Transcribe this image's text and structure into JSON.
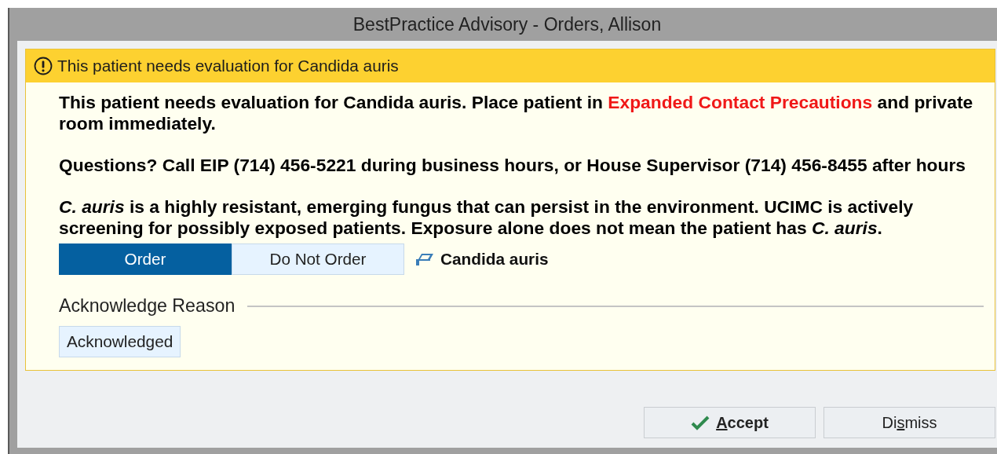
{
  "window": {
    "title": "BestPractice Advisory - Orders, Allison"
  },
  "advisory": {
    "header": "This patient needs evaluation for Candida auris",
    "paragraphs": [
      [
        {
          "kind": "plain",
          "text": "This patient needs evaluation for Candida auris. Place patient in "
        },
        {
          "kind": "highlight",
          "text": "Expanded Contact Precautions"
        },
        {
          "kind": "plain",
          "text": " and private room immediately."
        }
      ],
      [
        {
          "kind": "plain",
          "text": "Questions? Call EIP (714) 456-5221 during business hours, or House Supervisor (714) 456-8455 after hours"
        }
      ],
      [
        {
          "kind": "plain",
          "text": "*C. auris* is a highly resistant, emerging fungus that can persist in the environment. UCIMC is actively screening for possibly exposed patients. Exposure alone does not mean the patient has *C. auris*."
        }
      ]
    ],
    "order_options": [
      {
        "label": "Order",
        "selected": true
      },
      {
        "label": "Do Not Order",
        "selected": false
      }
    ],
    "order_name": "Candida auris",
    "acknowledge": {
      "title": "Acknowledge Reason",
      "options": [
        {
          "label": "Acknowledged",
          "selected": false
        }
      ]
    }
  },
  "footer_buttons": [
    {
      "kind": "primary",
      "parts": [
        {
          "text": "A",
          "underlined": true
        },
        {
          "text": "ccept",
          "underlined": false
        }
      ]
    },
    {
      "kind": "plain",
      "parts": [
        {
          "text": "Di",
          "underlined": false
        },
        {
          "text": "s",
          "underlined": true
        },
        {
          "text": "miss",
          "underlined": false
        }
      ]
    }
  ]
}
